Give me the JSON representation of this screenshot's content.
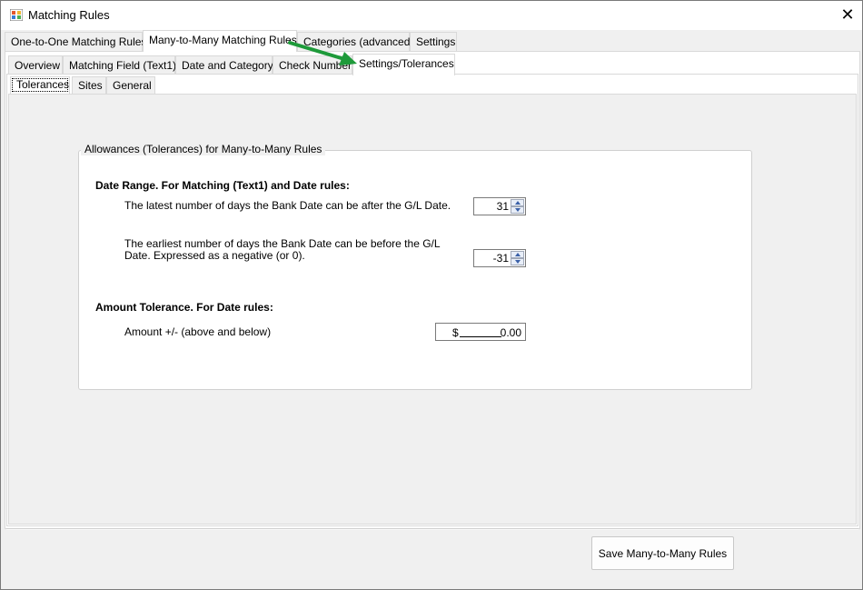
{
  "window": {
    "title": "Matching Rules",
    "close_glyph": "✕",
    "icon": "app-grid-icon"
  },
  "top_tabs": [
    {
      "label": "One-to-One Matching Rules",
      "active": false
    },
    {
      "label": "Many-to-Many Matching Rules",
      "active": true
    },
    {
      "label": "Categories (advanced)",
      "active": false
    },
    {
      "label": "Settings",
      "active": false
    }
  ],
  "second_tabs": [
    {
      "label": "Overview",
      "active": false
    },
    {
      "label": "Matching Field (Text1)",
      "active": false
    },
    {
      "label": "Date and Category",
      "active": false
    },
    {
      "label": "Check Number",
      "active": false
    },
    {
      "label": "Settings/Tolerances",
      "active": true
    }
  ],
  "third_tabs": [
    {
      "label": "Tolerances",
      "active": true
    },
    {
      "label": "Sites",
      "active": false
    },
    {
      "label": "General",
      "active": false
    }
  ],
  "group": {
    "legend": "Allowances (Tolerances) for Many-to-Many Rules",
    "date_range_heading": "Date Range.  For Matching (Text1) and Date rules:",
    "latest_label": "The latest number of days the Bank Date can be after the G/L Date.",
    "latest_value": "31",
    "earliest_label_line1": "The earliest number of days the Bank Date can be before the G/L",
    "earliest_label_line2": "Date. Expressed as a negative (or 0).",
    "earliest_value": "-31",
    "amount_heading": "Amount Tolerance.  For Date rules:",
    "amount_label": "Amount +/- (above and below)",
    "amount_currency": "$",
    "amount_value": "0.00"
  },
  "footer": {
    "save_label": "Save Many-to-Many Rules"
  },
  "colors": {
    "annotation_arrow": "#1e9a3a",
    "accent": "#3a60a8"
  }
}
